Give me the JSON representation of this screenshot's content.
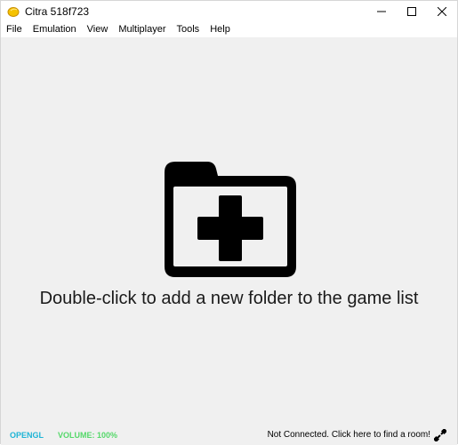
{
  "window": {
    "title": "Citra 518f723"
  },
  "menu": [
    "File",
    "Emulation",
    "View",
    "Multiplayer",
    "Tools",
    "Help"
  ],
  "main": {
    "hint_text": "Double-click to add a new folder to the game list",
    "icon": "add-folder-icon"
  },
  "statusbar": {
    "renderer": "OPENGL",
    "volume": "VOLUME: 100%",
    "network": "Not Connected. Click here to find a room!"
  },
  "colors": {
    "renderer": "#1eb4d6",
    "volume": "#55d86a",
    "background": "#f0f0f0"
  }
}
